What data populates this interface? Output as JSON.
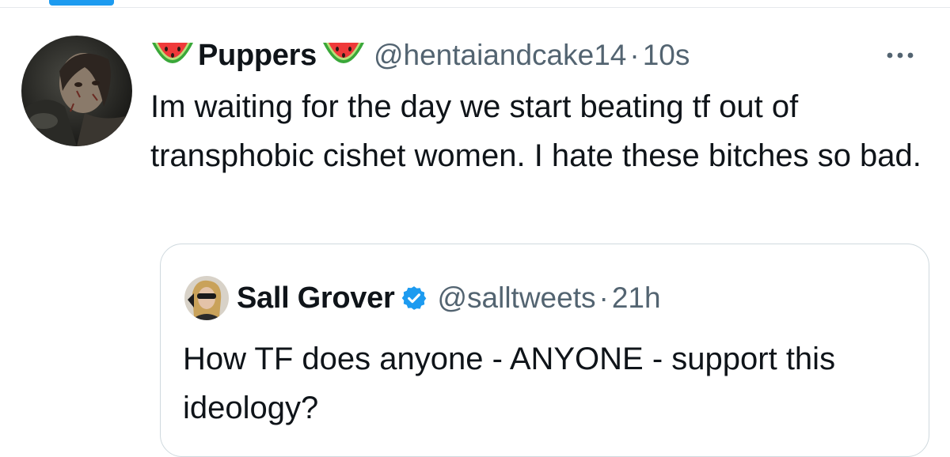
{
  "tweet": {
    "author_name": "Puppers",
    "name_prefix_emoji": "watermelon-icon",
    "name_suffix_emoji": "watermelon-icon",
    "handle": "@hentaiandcake14",
    "separator": "·",
    "time": "10s",
    "more_icon": "more-horizontal-icon",
    "text": "Im waiting for the day we start beating tf out of transphobic cishet women. I hate these bitches so bad."
  },
  "quoted_tweet": {
    "author_name": "Sall Grover",
    "verified_icon": "verified-badge-icon",
    "handle": "@salltweets",
    "separator": "·",
    "time": "21h",
    "text": "How TF does anyone - ANYONE - support this ideology?"
  },
  "colors": {
    "accent": "#1d9bf0",
    "text_primary": "#0f1419",
    "text_secondary": "#536471",
    "border": "#cfd9de"
  }
}
